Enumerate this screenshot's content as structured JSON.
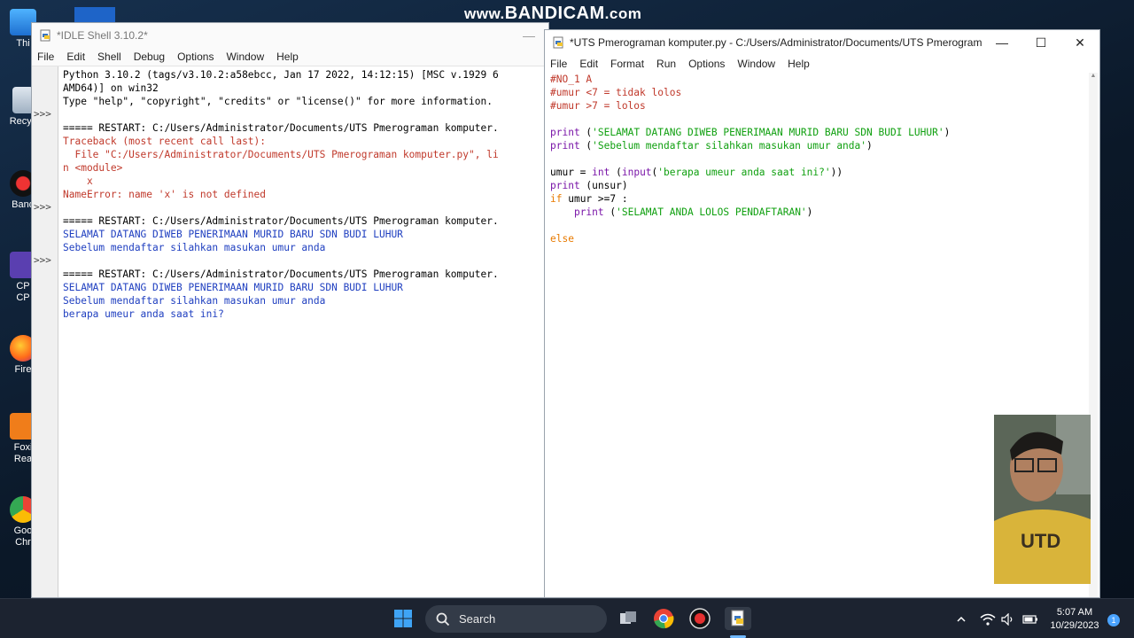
{
  "watermark": {
    "prefix": "www.",
    "brand": "BANDICAM",
    "suffix": ".com"
  },
  "desktop_icons": [
    {
      "label": "Thi",
      "icon": "this-pc-icon"
    },
    {
      "label": "Recyc",
      "icon": "recycle-bin-icon"
    },
    {
      "label": "Band",
      "icon": "bandicam-icon"
    },
    {
      "label": "CP",
      "label2": "CP",
      "icon": "cpu-z-icon"
    },
    {
      "label": "Fire",
      "icon": "firefox-icon"
    },
    {
      "label": "Foxi",
      "label2": "Rea",
      "icon": "foxit-reader-icon"
    },
    {
      "label": "Goo",
      "label2": "Chr",
      "icon": "chrome-icon"
    }
  ],
  "shell": {
    "title": "*IDLE Shell 3.10.2*",
    "menu": [
      "File",
      "Edit",
      "Shell",
      "Debug",
      "Options",
      "Window",
      "Help"
    ],
    "minimize": "—",
    "prompts": [
      ">>>",
      ">>>",
      ">>>"
    ],
    "lines": [
      {
        "text": "Python 3.10.2 (tags/v3.10.2:a58ebcc, Jan 17 2022, 14:12:15) [MSC v.1929 6",
        "color": "blk"
      },
      {
        "text": "AMD64)] on win32",
        "color": "blk"
      },
      {
        "text": "Type \"help\", \"copyright\", \"credits\" or \"license()\" for more information.",
        "color": "blk"
      },
      {
        "text": "",
        "color": "blk"
      },
      {
        "text": "===== RESTART: C:/Users/Administrator/Documents/UTS Pmerograman komputer.",
        "color": "blk"
      },
      {
        "text": "Traceback (most recent call last):",
        "color": "red"
      },
      {
        "text": "  File \"C:/Users/Administrator/Documents/UTS Pmerograman komputer.py\", li",
        "color": "red"
      },
      {
        "text": "n <module>",
        "color": "red"
      },
      {
        "text": "    x",
        "color": "red"
      },
      {
        "text": "NameError: name 'x' is not defined",
        "color": "red"
      },
      {
        "text": "",
        "color": "blk"
      },
      {
        "text": "===== RESTART: C:/Users/Administrator/Documents/UTS Pmerograman komputer.",
        "color": "blk"
      },
      {
        "text": "SELAMAT DATANG DIWEB PENERIMAAN MURID BARU SDN BUDI LUHUR",
        "color": "blu"
      },
      {
        "text": "Sebelum mendaftar silahkan masukan umur anda",
        "color": "blu"
      },
      {
        "text": "",
        "color": "blk"
      },
      {
        "text": "===== RESTART: C:/Users/Administrator/Documents/UTS Pmerograman komputer.",
        "color": "blk"
      },
      {
        "text": "SELAMAT DATANG DIWEB PENERIMAAN MURID BARU SDN BUDI LUHUR",
        "color": "blu"
      },
      {
        "text": "Sebelum mendaftar silahkan masukan umur anda",
        "color": "blu"
      },
      {
        "text": "berapa umeur anda saat ini?",
        "color": "blu"
      }
    ]
  },
  "editor": {
    "title": "*UTS Pmerograman komputer.py - C:/Users/Administrator/Documents/UTS Pmerograman ko...",
    "menu": [
      "File",
      "Edit",
      "Format",
      "Run",
      "Options",
      "Window",
      "Help"
    ],
    "controls": {
      "minimize": "—",
      "maximize": "☐",
      "close": "✕"
    },
    "lines": [
      [
        {
          "t": "#NO_1 A",
          "c": "red"
        }
      ],
      [
        {
          "t": "#umur <7 = tidak lolos",
          "c": "red"
        }
      ],
      [
        {
          "t": "#umur >7 = lolos",
          "c": "red"
        }
      ],
      [],
      [
        {
          "t": "print",
          "c": "pur"
        },
        {
          "t": " (",
          "c": "blk"
        },
        {
          "t": "'SELAMAT DATANG DIWEB PENERIMAAN MURID BARU SDN BUDI LUHUR'",
          "c": "grn"
        },
        {
          "t": ")",
          "c": "blk"
        }
      ],
      [
        {
          "t": "print",
          "c": "pur"
        },
        {
          "t": " (",
          "c": "blk"
        },
        {
          "t": "'Sebelum mendaftar silahkan masukan umur anda'",
          "c": "grn"
        },
        {
          "t": ")",
          "c": "blk"
        }
      ],
      [],
      [
        {
          "t": "umur = ",
          "c": "blk"
        },
        {
          "t": "int",
          "c": "pur"
        },
        {
          "t": " (",
          "c": "blk"
        },
        {
          "t": "input",
          "c": "pur"
        },
        {
          "t": "(",
          "c": "blk"
        },
        {
          "t": "'berapa umeur anda saat ini?'",
          "c": "grn"
        },
        {
          "t": "))",
          "c": "blk"
        }
      ],
      [
        {
          "t": "print",
          "c": "pur"
        },
        {
          "t": " (unsur)",
          "c": "blk"
        }
      ],
      [
        {
          "t": "if",
          "c": "org"
        },
        {
          "t": " umur >=7 :",
          "c": "blk"
        }
      ],
      [
        {
          "t": "    ",
          "c": "blk"
        },
        {
          "t": "print",
          "c": "pur"
        },
        {
          "t": " (",
          "c": "blk"
        },
        {
          "t": "'SELAMAT ANDA LOLOS PENDAFTARAN'",
          "c": "grn"
        },
        {
          "t": ")",
          "c": "blk"
        }
      ],
      [],
      [
        {
          "t": "else",
          "c": "org"
        }
      ]
    ]
  },
  "taskbar": {
    "search_label": "Search",
    "apps": [
      "windows-start-icon",
      "search-icon",
      "task-view-icon",
      "chrome-icon",
      "bandicam-record-icon",
      "idle-python-icon"
    ],
    "tray": [
      "chevron-up-icon",
      "wifi-icon",
      "volume-icon",
      "battery-icon"
    ],
    "time": "5:07 AM",
    "date": "10/29/2023",
    "notifications": "1"
  }
}
